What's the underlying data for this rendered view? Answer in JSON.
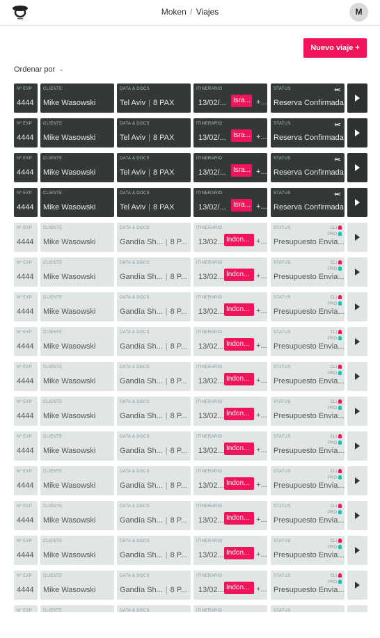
{
  "header": {
    "crumb_root": "Moken",
    "crumb_sep": "/",
    "crumb_current": "Viajes",
    "avatar_initial": "M"
  },
  "actions": {
    "new_trip_label": "Nuevo viaje +"
  },
  "sort": {
    "label": "Ordenar por",
    "icon": "chevron-down-icon"
  },
  "columns": {
    "exp": "Nº EXP",
    "cliente": "CLIENTE",
    "data": "DATA & DOCS",
    "itinerario": "ITINERARIO",
    "status": "STATUS"
  },
  "colors": {
    "accent": "#f0145a",
    "dark_row": "#333939",
    "light_row": "#e0e6e6",
    "teal": "#1fbfb0"
  },
  "rows": [
    {
      "variant": "dark",
      "exp": "4444",
      "cliente": "Mike Wasowski",
      "city": "Tel Aviv",
      "sep": "|",
      "pax": "8 PAX",
      "date": "13/02/...",
      "tag": "Isra...",
      "plus": "+...",
      "status": "Reserva Confirmada",
      "flag_cli": "",
      "flag_pro": ""
    },
    {
      "variant": "dark",
      "exp": "4444",
      "cliente": "Mike Wasowski",
      "city": "Tel Aviv",
      "sep": "|",
      "pax": "8 PAX",
      "date": "13/02/...",
      "tag": "Isra...",
      "plus": "+...",
      "status": "Reserva Confirmada",
      "flag_cli": "",
      "flag_pro": ""
    },
    {
      "variant": "dark",
      "exp": "4444",
      "cliente": "Mike Wasowski",
      "city": "Tel Aviv",
      "sep": "|",
      "pax": "8 PAX",
      "date": "13/02/...",
      "tag": "Isra...",
      "plus": "+...",
      "status": "Reserva Confirmada",
      "flag_cli": "",
      "flag_pro": ""
    },
    {
      "variant": "dark",
      "exp": "4444",
      "cliente": "Mike Wasowski",
      "city": "Tel Aviv",
      "sep": "|",
      "pax": "8 PAX",
      "date": "13/02/...",
      "tag": "Isra...",
      "plus": "+...",
      "status": "Reserva Confirmada",
      "flag_cli": "",
      "flag_pro": ""
    },
    {
      "variant": "light",
      "exp": "4444",
      "cliente": "Mike Wasowski",
      "city": "Gandía Sh...",
      "sep": "|",
      "pax": "8 P...",
      "date": "13/02...",
      "tag": "Indon...",
      "plus": "+...",
      "status": "Presupuesto Envia...",
      "flag_cli": "CLI",
      "flag_pro": "PRO"
    },
    {
      "variant": "light",
      "exp": "4444",
      "cliente": "Mike Wasowski",
      "city": "Gandía Sh...",
      "sep": "|",
      "pax": "8 P...",
      "date": "13/02...",
      "tag": "Indon...",
      "plus": "+...",
      "status": "Presupuesto Envia...",
      "flag_cli": "CLI",
      "flag_pro": "PRO"
    },
    {
      "variant": "light",
      "exp": "4444",
      "cliente": "Mike Wasowski",
      "city": "Gandía Sh...",
      "sep": "|",
      "pax": "8 P...",
      "date": "13/02...",
      "tag": "Indon...",
      "plus": "+...",
      "status": "Presupuesto Envia...",
      "flag_cli": "CLI",
      "flag_pro": "PRO"
    },
    {
      "variant": "light",
      "exp": "4444",
      "cliente": "Mike Wasowski",
      "city": "Gandía Sh...",
      "sep": "|",
      "pax": "8 P...",
      "date": "13/02...",
      "tag": "Indon...",
      "plus": "+...",
      "status": "Presupuesto Envia...",
      "flag_cli": "CLI",
      "flag_pro": "PRO"
    },
    {
      "variant": "light",
      "exp": "4444",
      "cliente": "Mike Wasowski",
      "city": "Gandía Sh...",
      "sep": "|",
      "pax": "8 P...",
      "date": "13/02...",
      "tag": "Indon...",
      "plus": "+...",
      "status": "Presupuesto Envia...",
      "flag_cli": "CLI",
      "flag_pro": "PRO"
    },
    {
      "variant": "light",
      "exp": "4444",
      "cliente": "Mike Wasowski",
      "city": "Gandía Sh...",
      "sep": "|",
      "pax": "8 P...",
      "date": "13/02...",
      "tag": "Indon...",
      "plus": "+...",
      "status": "Presupuesto Envia...",
      "flag_cli": "CLI",
      "flag_pro": "PRO"
    },
    {
      "variant": "light",
      "exp": "4444",
      "cliente": "Mike Wasowski",
      "city": "Gandía Sh...",
      "sep": "|",
      "pax": "8 P...",
      "date": "13/02...",
      "tag": "Indon...",
      "plus": "+...",
      "status": "Presupuesto Envia...",
      "flag_cli": "CLI",
      "flag_pro": "PRO"
    },
    {
      "variant": "light",
      "exp": "4444",
      "cliente": "Mike Wasowski",
      "city": "Gandía Sh...",
      "sep": "|",
      "pax": "8 P...",
      "date": "13/02...",
      "tag": "Indon...",
      "plus": "+...",
      "status": "Presupuesto Envia...",
      "flag_cli": "CLI",
      "flag_pro": "PRO"
    },
    {
      "variant": "light",
      "exp": "4444",
      "cliente": "Mike Wasowski",
      "city": "Gandía Sh...",
      "sep": "|",
      "pax": "8 P...",
      "date": "13/02...",
      "tag": "Indon...",
      "plus": "+...",
      "status": "Presupuesto Envia...",
      "flag_cli": "CLI",
      "flag_pro": "PRO"
    },
    {
      "variant": "light",
      "exp": "4444",
      "cliente": "Mike Wasowski",
      "city": "Gandía Sh...",
      "sep": "|",
      "pax": "8 P...",
      "date": "13/02...",
      "tag": "Indon...",
      "plus": "+...",
      "status": "Presupuesto Envia...",
      "flag_cli": "CLI",
      "flag_pro": "PRO"
    },
    {
      "variant": "light",
      "exp": "4444",
      "cliente": "Mike Wasowski",
      "city": "Gandía Sh...",
      "sep": "|",
      "pax": "8 P...",
      "date": "13/02...",
      "tag": "Indon...",
      "plus": "+...",
      "status": "Presupuesto Envia...",
      "flag_cli": "CLI",
      "flag_pro": "PRO"
    },
    {
      "variant": "light",
      "exp": "",
      "cliente": "",
      "city": "",
      "sep": "",
      "pax": "",
      "date": "",
      "tag": "",
      "plus": "",
      "status": "",
      "flag_cli": "",
      "flag_pro": ""
    }
  ]
}
